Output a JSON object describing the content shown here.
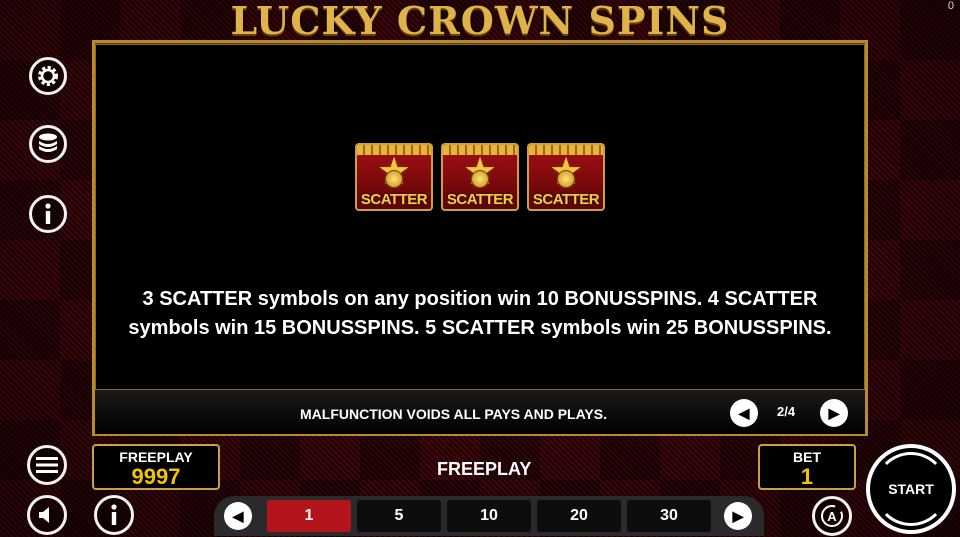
{
  "game": {
    "title": "LUCKY CROWN SPINS",
    "corner_counter": "0"
  },
  "paytable": {
    "symbols": [
      {
        "label": "SCATTER"
      },
      {
        "label": "SCATTER"
      },
      {
        "label": "SCATTER"
      }
    ],
    "description": "3 SCATTER symbols on any position win 10 BONUSSPINS. 4 SCATTER symbols win 15 BONUSSPINS. 5 SCATTER symbols win 25 BONUSSPINS.",
    "disclaimer": "MALFUNCTION VOIDS ALL PAYS AND PLAYS.",
    "page_indicator": "2/4"
  },
  "balance": {
    "label": "FREEPLAY",
    "value": "9997"
  },
  "mode_label": "FREEPLAY",
  "bet": {
    "label": "BET",
    "value": "1"
  },
  "bet_options": [
    "1",
    "5",
    "10",
    "20",
    "30"
  ],
  "selected_bet": "1",
  "start_label": "START",
  "icons": {
    "settings": "gear-icon",
    "coins": "coin-stack-icon",
    "info": "info-icon",
    "menu": "hamburger-menu-icon",
    "sound": "speaker-icon",
    "autoplay": "autoplay-icon"
  },
  "colors": {
    "accent_gold": "#c9a04a",
    "selected_bet": "#b3141c",
    "value_yellow": "#f0c400"
  }
}
